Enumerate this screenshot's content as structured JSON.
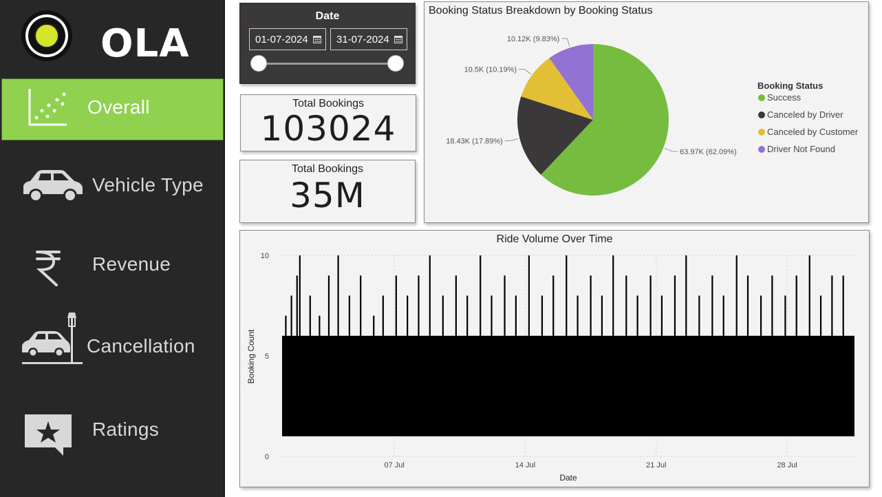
{
  "app": {
    "brand": "OLA",
    "colors": {
      "sidebar": "#272727",
      "active": "#90d24f",
      "panel": "#f3f3f3"
    }
  },
  "sidebar": {
    "items": [
      {
        "label": "Overall",
        "icon": "scatter-chart-icon",
        "active": true
      },
      {
        "label": "Vehicle Type",
        "icon": "car-icon",
        "active": false
      },
      {
        "label": "Revenue",
        "icon": "rupee-icon",
        "active": false
      },
      {
        "label": "Cancellation",
        "icon": "car-crash-icon",
        "active": false
      },
      {
        "label": "Ratings",
        "icon": "star-speech-icon",
        "active": false
      }
    ]
  },
  "date_slicer": {
    "title": "Date",
    "start": "01-07-2024",
    "end": "31-07-2024",
    "range_start_fraction": 0,
    "range_end_fraction": 1
  },
  "kpis": [
    {
      "label": "Total Bookings",
      "value": "103024"
    },
    {
      "label": "Total Bookings",
      "value": "35M"
    }
  ],
  "pie_chart": {
    "title": "Booking Status Breakdown by Booking Status",
    "legend_title": "Booking Status"
  },
  "line_chart": {
    "title": "Ride Volume Over Time",
    "xlabel": "Date",
    "ylabel": "Booking Count"
  },
  "chart_data": [
    {
      "type": "pie",
      "title": "Booking Status Breakdown by Booking Status",
      "legend_title": "Booking Status",
      "legend_placement": "right",
      "slices": [
        {
          "name": "Success",
          "value": 63970,
          "label": "63.97K (62.09%)",
          "color": "#76bc3f"
        },
        {
          "name": "Canceled by Driver",
          "value": 18430,
          "label": "18.43K (17.89%)",
          "color": "#3a3838"
        },
        {
          "name": "Canceled by Customer",
          "value": 10500,
          "label": "10.5K (10.19%)",
          "color": "#e2bf34"
        },
        {
          "name": "Driver Not Found",
          "value": 10120,
          "label": "10.12K (9.83%)",
          "color": "#9273d4"
        }
      ]
    },
    {
      "type": "line",
      "title": "Ride Volume Over Time",
      "xlabel": "Date",
      "ylabel": "Booking Count",
      "ylim": [
        0,
        10
      ],
      "yticks": [
        0,
        5,
        10
      ],
      "xticks": [
        "07 Jul",
        "14 Jul",
        "21 Jul",
        "28 Jul"
      ],
      "grid": true,
      "series_color": "#000000",
      "dense_band": [
        1,
        6
      ],
      "peaks": [
        {
          "day": 1.2,
          "value": 7
        },
        {
          "day": 1.5,
          "value": 8
        },
        {
          "day": 1.8,
          "value": 9
        },
        {
          "day": 1.95,
          "value": 10
        },
        {
          "day": 2.5,
          "value": 8
        },
        {
          "day": 3.0,
          "value": 7
        },
        {
          "day": 3.5,
          "value": 9
        },
        {
          "day": 4.0,
          "value": 10
        },
        {
          "day": 4.6,
          "value": 8
        },
        {
          "day": 5.2,
          "value": 9
        },
        {
          "day": 5.9,
          "value": 7
        },
        {
          "day": 6.4,
          "value": 8
        },
        {
          "day": 7.1,
          "value": 9
        },
        {
          "day": 7.7,
          "value": 8
        },
        {
          "day": 8.3,
          "value": 9
        },
        {
          "day": 8.9,
          "value": 10
        },
        {
          "day": 9.6,
          "value": 8
        },
        {
          "day": 10.3,
          "value": 9
        },
        {
          "day": 10.9,
          "value": 8
        },
        {
          "day": 11.6,
          "value": 10
        },
        {
          "day": 12.2,
          "value": 8
        },
        {
          "day": 12.9,
          "value": 9
        },
        {
          "day": 13.5,
          "value": 8
        },
        {
          "day": 14.2,
          "value": 10
        },
        {
          "day": 14.9,
          "value": 8
        },
        {
          "day": 15.5,
          "value": 9
        },
        {
          "day": 16.2,
          "value": 10
        },
        {
          "day": 16.8,
          "value": 8
        },
        {
          "day": 17.5,
          "value": 9
        },
        {
          "day": 18.1,
          "value": 8
        },
        {
          "day": 18.7,
          "value": 10
        },
        {
          "day": 19.4,
          "value": 9
        },
        {
          "day": 20.0,
          "value": 8
        },
        {
          "day": 20.7,
          "value": 9
        },
        {
          "day": 21.3,
          "value": 8
        },
        {
          "day": 22.0,
          "value": 9
        },
        {
          "day": 22.6,
          "value": 10
        },
        {
          "day": 23.3,
          "value": 8
        },
        {
          "day": 24.0,
          "value": 9
        },
        {
          "day": 24.6,
          "value": 8
        },
        {
          "day": 25.3,
          "value": 10
        },
        {
          "day": 25.9,
          "value": 9
        },
        {
          "day": 26.6,
          "value": 8
        },
        {
          "day": 27.2,
          "value": 9
        },
        {
          "day": 27.9,
          "value": 8
        },
        {
          "day": 28.5,
          "value": 9
        },
        {
          "day": 29.2,
          "value": 10
        },
        {
          "day": 29.8,
          "value": 8
        },
        {
          "day": 30.4,
          "value": 9
        },
        {
          "day": 31.0,
          "value": 9
        }
      ]
    }
  ]
}
